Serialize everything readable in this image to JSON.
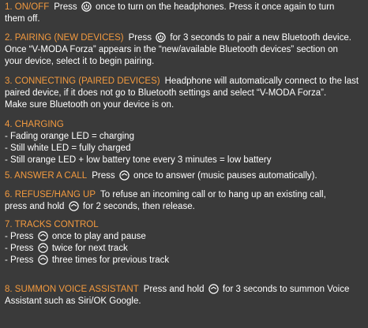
{
  "colors": {
    "background": "#3a3a3a",
    "heading": "#f39a3f",
    "text": "#ffffff"
  },
  "sections": [
    {
      "heading": "1. ON/OFF",
      "line1_a": "Press",
      "line1_b": "once to turn on the headphones. Press it once again to turn",
      "line2": "them off.",
      "icon": "power-button-icon"
    },
    {
      "heading": "2. PAIRING (NEW DEVICES)",
      "line1_a": "Press",
      "line1_b": "for 3 seconds to pair a new Bluetooth device.",
      "line2": "Once “V-MODA Forza” appears in the “new/available Bluetooth devices” section on",
      "line3": "your device, select it to begin pairing.",
      "icon": "power-button-icon"
    },
    {
      "heading": "3. CONNECTING (PAIRED DEVICES)",
      "line1": "Headphone will automatically connect to the last",
      "line2": "paired device, if it does not go to Bluetooth settings and select “V-MODA Forza”.",
      "line3": "Make sure Bluetooth on your device is on."
    },
    {
      "heading": "4. CHARGING",
      "items": [
        "- Fading orange LED = charging",
        "- Still white LED = fully charged",
        "- Still orange LED + low battery tone every 3 minutes = low battery"
      ]
    },
    {
      "heading": "5. ANSWER A CALL",
      "line1_a": "Press",
      "line1_b": "once to answer (music pauses automatically).",
      "icon": "multifunction-button-icon"
    },
    {
      "heading": "6. REFUSE/HANG UP",
      "line1": "To refuse an incoming call or to hang up an existing call,",
      "line2_a": "press and hold",
      "line2_b": "for 2 seconds, then release.",
      "icon": "multifunction-button-icon"
    },
    {
      "heading": "7. TRACKS CONTROL",
      "items": [
        {
          "a": "- Press",
          "b": "once to play and pause"
        },
        {
          "a": "- Press",
          "b": "twice for next track"
        },
        {
          "a": "- Press",
          "b": "three times for previous track"
        }
      ],
      "icon": "multifunction-button-icon"
    },
    {
      "heading": "8. SUMMON VOICE ASSISTANT",
      "line1_a": "Press and hold",
      "line1_b": "for 3 seconds to summon Voice",
      "line2": "Assistant such as Siri/OK Google.",
      "icon": "multifunction-button-icon"
    }
  ]
}
